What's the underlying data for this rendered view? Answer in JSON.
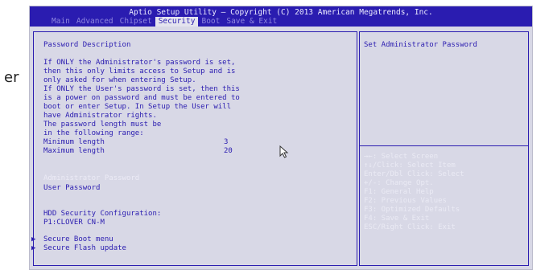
{
  "bios": {
    "title": "Aptio Setup Utility – Copyright (C) 2013 American Megatrends, Inc.",
    "tabs": [
      "Main",
      "Advanced",
      "Chipset",
      "Security",
      "Boot",
      "Save & Exit"
    ],
    "active_tab": "Security"
  },
  "outside_text": "er",
  "main": {
    "heading": "Password Description",
    "description": [
      "If ONLY the Administrator's password is set,",
      "then this only limits access to Setup and is",
      "only asked for when entering Setup.",
      "If ONLY the User's password is set, then this",
      "is a power on password and must be entered to",
      "boot or enter Setup. In Setup the User will",
      "have Administrator rights.",
      "The password length must be",
      "in the following range:"
    ],
    "min_label": "Minimum length",
    "min_value": "3",
    "max_label": "Maximum length",
    "max_value": "20",
    "admin_password": "Administrator Password",
    "user_password": "User Password",
    "hdd_heading": "HDD Security Configuration:",
    "hdd_device": "P1:CLOVER  CN-M",
    "secure_boot": "Secure Boot menu",
    "secure_flash": "Secure Flash update"
  },
  "help": {
    "item_help": "Set Administrator Password",
    "keys": [
      "→←: Select Screen",
      "↑↓/Click: Select Item",
      "Enter/Dbl Click: Select",
      "+/-: Change Opt.",
      "F1: General Help",
      "F2: Previous Values",
      "F3: Optimized Defaults",
      "F4: Save & Exit",
      "ESC/Right Click: Exit"
    ]
  },
  "colors": {
    "accent": "#2a1cb0",
    "panel_bg": "#d8d8e6",
    "highlight_text": "#ecebf6"
  }
}
